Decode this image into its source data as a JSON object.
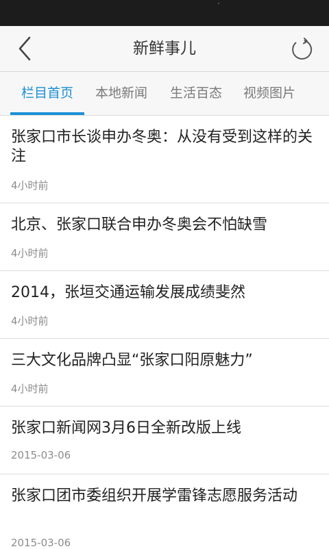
{
  "header": {
    "title": "新鲜事儿"
  },
  "tabs": [
    {
      "label": "栏目首页",
      "active": true
    },
    {
      "label": "本地新闻",
      "active": false
    },
    {
      "label": "生活百态",
      "active": false
    },
    {
      "label": "视频图片",
      "active": false
    }
  ],
  "news": [
    {
      "title": "张家口市长谈申办冬奥：从没有受到这样的关注",
      "time": "4小时前"
    },
    {
      "title": "北京、张家口联合申办冬奥会不怕缺雪",
      "time": "4小时前"
    },
    {
      "title": "2014，张垣交通运输发展成绩斐然",
      "time": "4小时前"
    },
    {
      "title": "三大文化品牌凸显“张家口阳原魅力”",
      "time": "4小时前"
    },
    {
      "title": "张家口新闻网3月6日全新改版上线",
      "time": "2015-03-06"
    },
    {
      "title": "张家口团市委组织开展学雷锋志愿服务活动",
      "time": "2015-03-06"
    }
  ],
  "colors": {
    "accent": "#1b8fd6",
    "header_bg": "#f7f7f7",
    "status_bar": "#1c1c1c"
  },
  "icons": {
    "back": "chevron-left-icon",
    "refresh": "refresh-icon"
  }
}
